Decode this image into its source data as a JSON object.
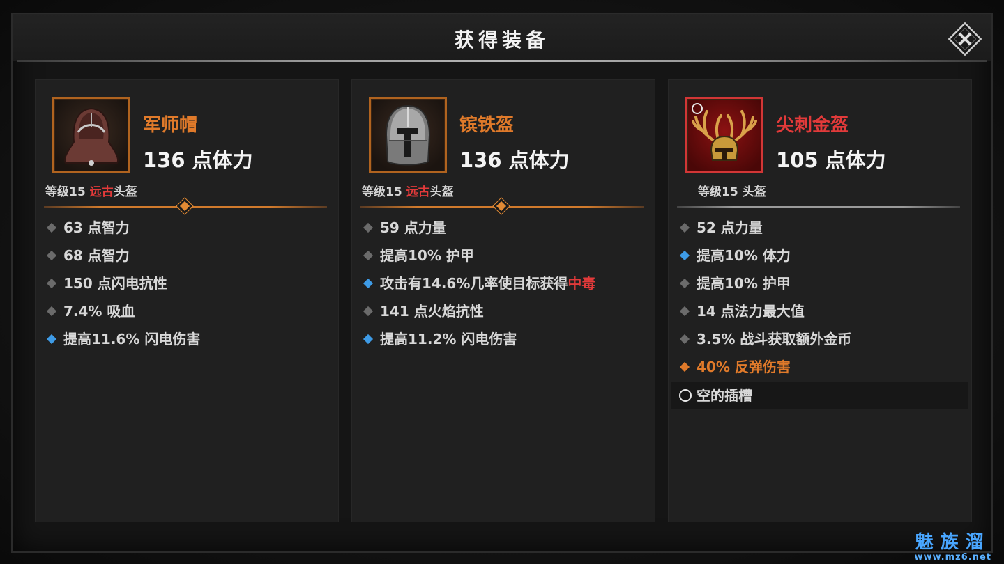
{
  "dialog": {
    "title": "获得装备"
  },
  "items": [
    {
      "name": "军师帽",
      "main_stat": "136 点体力",
      "type_prefix": "等级15 ",
      "type_rarity": "远古",
      "type_suffix": "头盔",
      "stats": [
        {
          "text": "63 点智力",
          "marker": "gray"
        },
        {
          "text": "68 点智力",
          "marker": "gray"
        },
        {
          "text": "150 点闪电抗性",
          "marker": "gray"
        },
        {
          "text": "7.4% 吸血",
          "marker": "gray"
        },
        {
          "text": "提高11.6% 闪电伤害",
          "marker": "blue"
        }
      ]
    },
    {
      "name": "镔铁盔",
      "main_stat": "136 点体力",
      "type_prefix": "等级15 ",
      "type_rarity": "远古",
      "type_suffix": "头盔",
      "stats": [
        {
          "text": "59 点力量",
          "marker": "gray"
        },
        {
          "text": "提高10% 护甲",
          "marker": "gray"
        },
        {
          "text": "攻击有14.6%几率使目标获得",
          "highlight": "中毒",
          "marker": "blue"
        },
        {
          "text": "141 点火焰抗性",
          "marker": "gray"
        },
        {
          "text": "提高11.2% 闪电伤害",
          "marker": "blue"
        }
      ]
    },
    {
      "name": "尖刺金盔",
      "main_stat": "105 点体力",
      "type_prefix": "等级15 ",
      "type_suffix": "头盔",
      "stats": [
        {
          "text": "52 点力量",
          "marker": "gray"
        },
        {
          "text": "提高10% 体力",
          "marker": "blue"
        },
        {
          "text": "提高10% 护甲",
          "marker": "gray"
        },
        {
          "text": "14 点法力最大值",
          "marker": "gray"
        },
        {
          "text": "3.5% 战斗获取额外金币",
          "marker": "gray"
        },
        {
          "text": "40% 反弹伤害",
          "marker": "orange"
        }
      ],
      "socket_label": "空的插槽"
    }
  ],
  "watermark": {
    "top": "魅族溜",
    "bottom": "www.mz6.net"
  },
  "colors": {
    "legendary_orange": "#e07a2a",
    "set_red": "#e23a3a",
    "magic_blue": "#3e9be6",
    "normal_gray": "#6b6b6b"
  }
}
